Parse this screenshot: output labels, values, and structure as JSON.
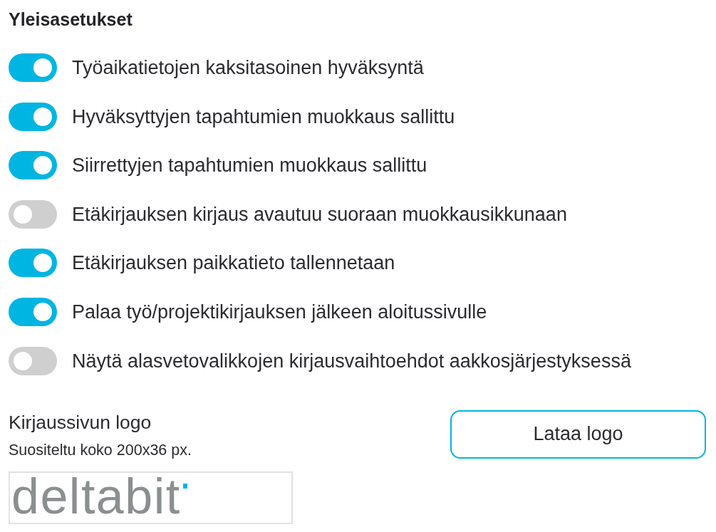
{
  "section_title": "Yleisasetukset",
  "settings": [
    {
      "label": "Työaikatietojen kaksitasoinen hyväksyntä",
      "on": true
    },
    {
      "label": "Hyväksyttyjen tapahtumien muokkaus sallittu",
      "on": true
    },
    {
      "label": "Siirrettyjen tapahtumien muokkaus sallittu",
      "on": true
    },
    {
      "label": "Etäkirjauksen kirjaus avautuu suoraan muokkausikkunaan",
      "on": false
    },
    {
      "label": "Etäkirjauksen paikkatieto tallennetaan",
      "on": true
    },
    {
      "label": "Palaa työ/projektikirjauksen jälkeen aloitussivulle",
      "on": true
    },
    {
      "label": "Näytä alasvetovalikkojen kirjausvaihtoehdot aakkosjärjestyksessä",
      "on": false
    }
  ],
  "logo": {
    "label": "Kirjaussivun logo",
    "hint": "Suositeltu koko 200x36 px.",
    "preview_text": "deltabit",
    "button": "Lataa logo"
  }
}
